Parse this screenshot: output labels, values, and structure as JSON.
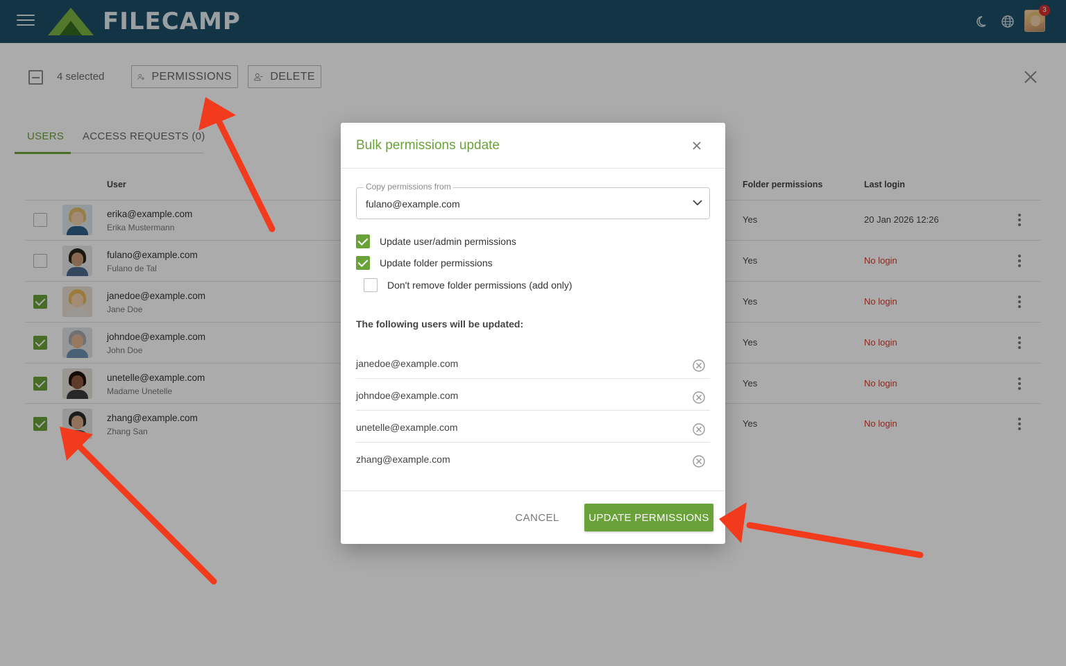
{
  "app": {
    "brand": "FILECAMP",
    "notification_count": "3"
  },
  "toolbar": {
    "selected_text": "4 selected",
    "permissions_label": "PERMISSIONS",
    "delete_label": "DELETE"
  },
  "tabs": [
    {
      "label": "USERS",
      "active": true
    },
    {
      "label": "ACCESS REQUESTS (0)",
      "active": false
    }
  ],
  "table": {
    "headers": {
      "user": "User",
      "folder_permissions": "Folder permissions",
      "last_login": "Last login"
    },
    "rows": [
      {
        "email": "erika@example.com",
        "name": "Erika Mustermann",
        "checked": false,
        "folder_permissions": "Yes",
        "last_login": "20 Jan 2026 12:26"
      },
      {
        "email": "fulano@example.com",
        "name": "Fulano de Tal",
        "checked": false,
        "folder_permissions": "Yes",
        "last_login": "No login"
      },
      {
        "email": "janedoe@example.com",
        "name": "Jane Doe",
        "checked": true,
        "folder_permissions": "Yes",
        "last_login": "No login"
      },
      {
        "email": "johndoe@example.com",
        "name": "John Doe",
        "checked": true,
        "folder_permissions": "Yes",
        "last_login": "No login"
      },
      {
        "email": "unetelle@example.com",
        "name": "Madame Unetelle",
        "checked": true,
        "folder_permissions": "Yes",
        "last_login": "No login"
      },
      {
        "email": "zhang@example.com",
        "name": "Zhang San",
        "checked": true,
        "folder_permissions": "Yes",
        "last_login": "No login"
      }
    ]
  },
  "modal": {
    "title": "Bulk permissions update",
    "copy_label": "Copy permissions from",
    "copy_value": "fulano@example.com",
    "options": [
      {
        "label": "Update user/admin permissions",
        "checked": true
      },
      {
        "label": "Update folder permissions",
        "checked": true
      },
      {
        "label": "Don't remove folder permissions (add only)",
        "checked": false
      }
    ],
    "following_text": "The following users will be updated:",
    "users": [
      "janedoe@example.com",
      "johndoe@example.com",
      "unetelle@example.com",
      "zhang@example.com"
    ],
    "cancel_label": "CANCEL",
    "update_label": "UPDATE PERMISSIONS"
  },
  "colors": {
    "topbar": "#1d4e68",
    "accent_green": "#6aa23a",
    "no_login_red": "#d63a2f",
    "annotation_arrow": "#f23a1d"
  },
  "icons": [
    "menu-icon",
    "moon-icon",
    "globe-icon",
    "users-gear-icon",
    "user-minus-icon",
    "close-icon",
    "chevron-down-icon",
    "remove-circle-icon",
    "kebab-icon"
  ]
}
